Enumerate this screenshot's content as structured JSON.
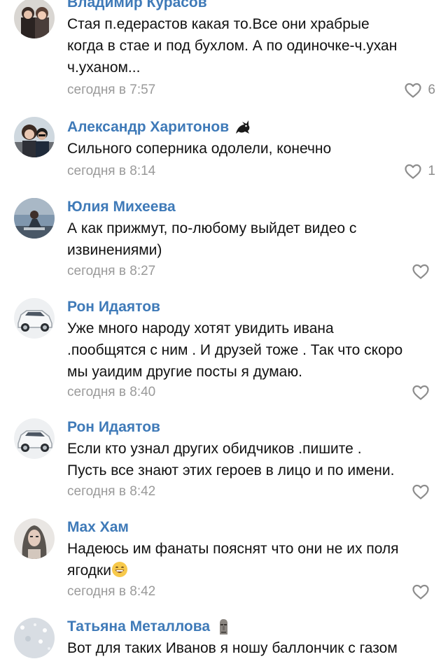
{
  "comments": [
    {
      "author": "Владимир Курасов",
      "text": "Стая п.едерастов какая то.Все они храбрые\nкогда в стае и под бухлом. А по одиночке-ч.ухан\nч.уханом...",
      "time": "сегодня в 7:57",
      "likes": "6",
      "avatar_icon": "couple-photo-avatar"
    },
    {
      "author": "Александр Харитонов",
      "text": "Сильного соперника одолели, конечно",
      "time": "сегодня в 8:14",
      "likes": "1",
      "avatar_icon": "couple-sunglasses-avatar",
      "badge_icon": "dragon-icon"
    },
    {
      "author": "Юлия Михеева",
      "text": "А как прижмут, по-любому выйдет видео с\nизвинениями)",
      "time": "сегодня в 8:27",
      "likes": "",
      "avatar_icon": "woman-sitting-avatar"
    },
    {
      "author": "Рон Идаятов",
      "text": "Уже много народу хотят увидить ивана\n.пообщятся с ним . И друзей тоже . Так что скоро\nмы уаидим другие посты я думаю.",
      "time": "сегодня в 8:40",
      "likes": "",
      "avatar_icon": "white-suv-avatar"
    },
    {
      "author": "Рон Идаятов",
      "text": "Если кто узнал других обидчиков .пишите .\nПусть все знают этих героев в лицо и по имени.",
      "time": "сегодня в 8:42",
      "likes": "",
      "avatar_icon": "white-suv-avatar"
    },
    {
      "author": "Max Хам",
      "text": "Надеюсь им фанаты пояснят что они не их поля\nягодки",
      "time": "сегодня в 8:42",
      "likes": "",
      "avatar_icon": "woman-portrait-avatar",
      "inline_emoji": "grinning-face-emoji"
    },
    {
      "author": "Татьяна Металлова",
      "text": "Вот для таких Иванов я ношу баллончик с газом",
      "time": "",
      "likes": "",
      "avatar_icon": "glitter-avatar",
      "badge_icon": "moai-icon"
    }
  ],
  "colors": {
    "author": "#3f7ab8",
    "timestamp": "#9a9a9a",
    "like_icon": "#8d8d8d"
  }
}
